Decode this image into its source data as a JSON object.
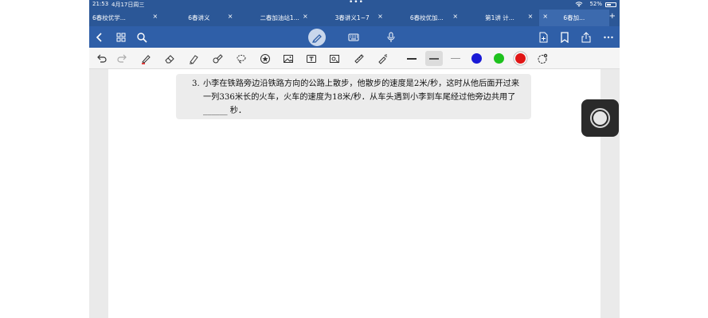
{
  "status_bar": {
    "time": "21:53",
    "date": "4月17日周三",
    "battery": "52%"
  },
  "tabs": [
    {
      "label": "6春校优学...",
      "close": "×",
      "active": false
    },
    {
      "label": "6春讲义",
      "close": "×",
      "active": false
    },
    {
      "label": "二春加油站1...",
      "close": "×",
      "active": false
    },
    {
      "label": "3春讲义1~7",
      "close": "×",
      "active": false
    },
    {
      "label": "6春校优加...",
      "close": "×",
      "active": false
    },
    {
      "label": "第1讲  计...",
      "close": "×",
      "active": false
    },
    {
      "label": "6春加...",
      "close": "×",
      "active": true
    }
  ],
  "tab_add": "+",
  "icons": {
    "back": "chevron-left-icon",
    "grid": "grid-icon",
    "search": "search-icon",
    "pen": "pen-icon",
    "keyboard": "keyboard-icon",
    "mic": "microphone-icon",
    "add_page": "add-page-icon",
    "bookmark": "bookmark-icon",
    "share": "share-icon",
    "more": "more-icon"
  },
  "toolbar": {
    "colors": {
      "blue": "#1a1ad6",
      "green": "#1ec21e",
      "red": "#e01616"
    }
  },
  "question": {
    "number": "3.",
    "text": "小李在铁路旁边沿铁路方向的公路上散步，他散步的速度是2米/秒，这时从他后面开过来一列336米长的火车，火车的速度为18米/秒．从车头遇到小李到车尾经过他旁边共用了 ______ 秒．"
  }
}
